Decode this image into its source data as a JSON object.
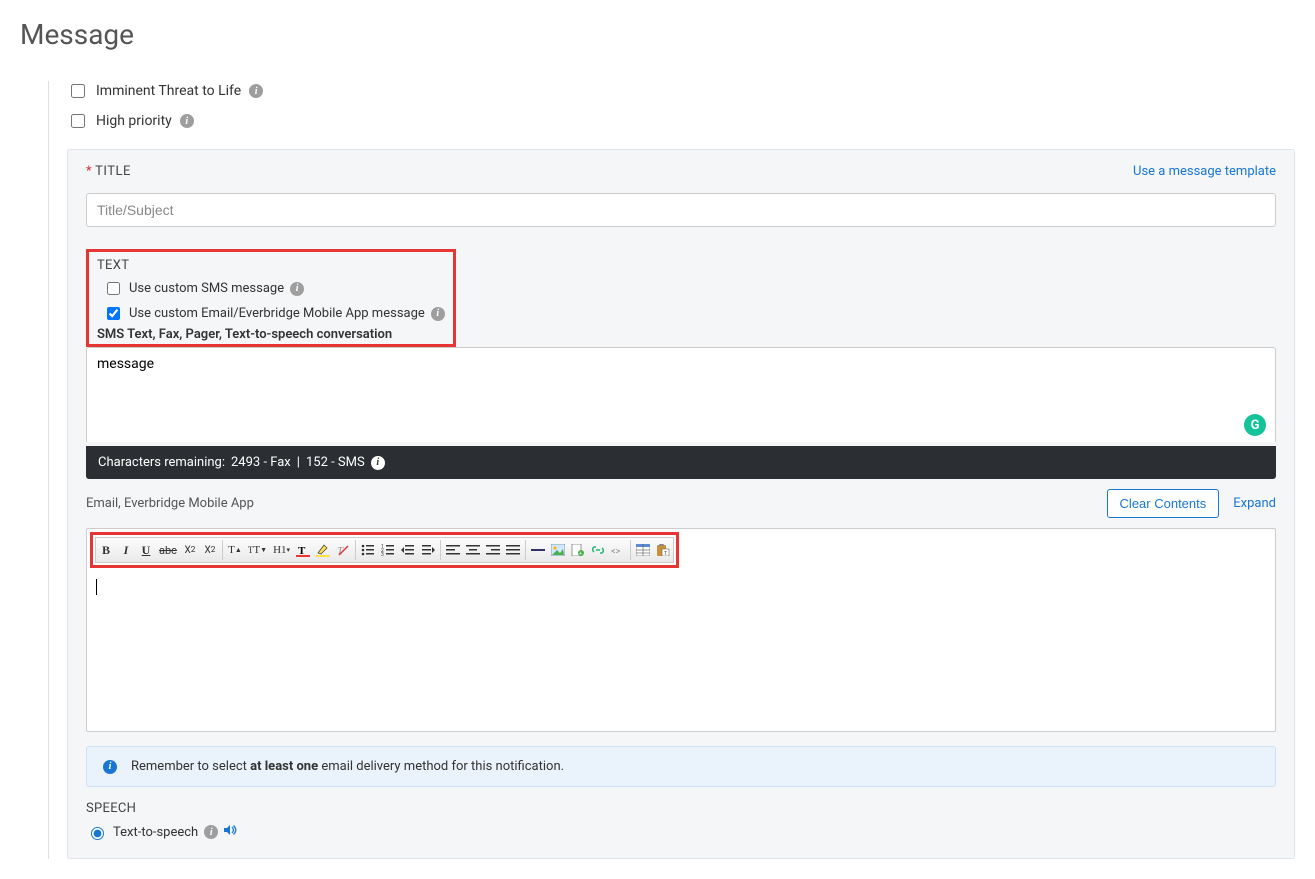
{
  "page": {
    "title": "Message"
  },
  "options": {
    "imminent_threat_label": "Imminent Threat to Life",
    "high_priority_label": "High priority"
  },
  "title_section": {
    "label": "TITLE",
    "placeholder": "Title/Subject",
    "template_link": "Use a message template"
  },
  "text_section": {
    "label": "TEXT",
    "use_custom_sms_label": "Use custom SMS message",
    "use_custom_email_label": "Use custom Email/Everbridge Mobile App message",
    "sms_types_label": "SMS Text, Fax, Pager, Text-to-speech conversation",
    "message_value": "message",
    "char_remaining_prefix": "Characters remaining:",
    "fax_count": "2493 - Fax",
    "sms_count": "152 - SMS",
    "separator": "|"
  },
  "email_section": {
    "label": "Email, Everbridge Mobile App",
    "clear_button": "Clear Contents",
    "expand_link": "Expand"
  },
  "alert": {
    "text_before": "Remember to select ",
    "text_bold": "at least one",
    "text_after": " email delivery method for this notification."
  },
  "speech": {
    "label": "SPEECH",
    "tts_label": "Text-to-speech"
  }
}
